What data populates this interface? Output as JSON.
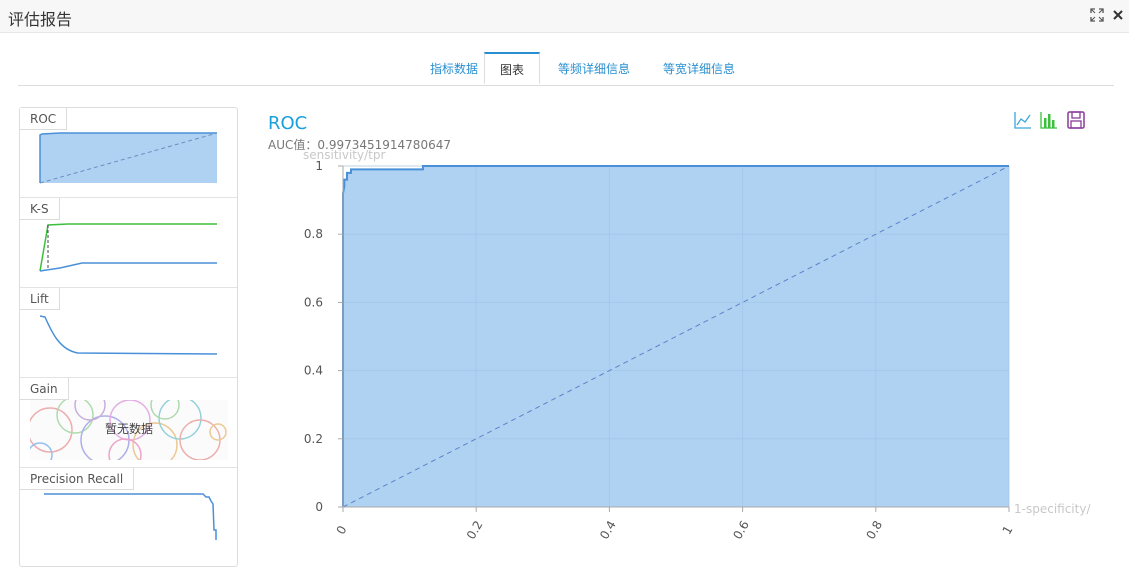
{
  "window": {
    "title": "评估报告",
    "controls": [
      {
        "name": "maximize-icon",
        "glyph": "⛶"
      },
      {
        "name": "close-icon",
        "glyph": "✕"
      }
    ]
  },
  "tabs": [
    {
      "label": "指标数据",
      "active": false
    },
    {
      "label": "图表",
      "active": true
    },
    {
      "label": "等频详细信息",
      "active": false
    },
    {
      "label": "等宽详细信息",
      "active": false
    }
  ],
  "sidebar": {
    "thumbnails": [
      {
        "label": "ROC"
      },
      {
        "label": "K-S"
      },
      {
        "label": "Lift"
      },
      {
        "label": "Gain",
        "placeholder": "暂无数据"
      },
      {
        "label": "Precision Recall"
      }
    ]
  },
  "chart": {
    "title": "ROC",
    "auc_text": "AUC值：0.9973451914780647",
    "toolbar": [
      {
        "name": "line-chart-icon",
        "color": "#3aa6dc"
      },
      {
        "name": "bar-chart-icon",
        "color": "#3cbf3c"
      },
      {
        "name": "save-icon",
        "color": "#8a3a9a"
      }
    ]
  },
  "colors": {
    "accent": "#1aa0dc",
    "area_fill": "#afd1f2",
    "line": "#4a90d9",
    "ks_green": "#3cbf3c"
  },
  "chart_data": {
    "type": "area",
    "title": "ROC",
    "xlabel": "1-specificity/",
    "ylabel": "sensitivity/tpr",
    "xlim": [
      0,
      1
    ],
    "ylim": [
      0,
      1
    ],
    "x_ticks": [
      "0",
      "0.2",
      "0.4",
      "0.6",
      "0.8",
      "1"
    ],
    "y_ticks": [
      "0",
      "0.2",
      "0.4",
      "0.6",
      "0.8",
      "1"
    ],
    "grid": true,
    "series": [
      {
        "x": [
          0,
          0,
          0.002,
          0.002,
          0.006,
          0.006,
          0.012,
          0.012,
          0.12,
          0.12,
          1
        ],
        "y": [
          0,
          0.92,
          0.94,
          0.96,
          0.96,
          0.98,
          0.98,
          0.99,
          0.99,
          1,
          1
        ]
      }
    ],
    "reference_line": {
      "x": [
        0,
        1
      ],
      "y": [
        0,
        1
      ],
      "style": "dashed"
    }
  }
}
